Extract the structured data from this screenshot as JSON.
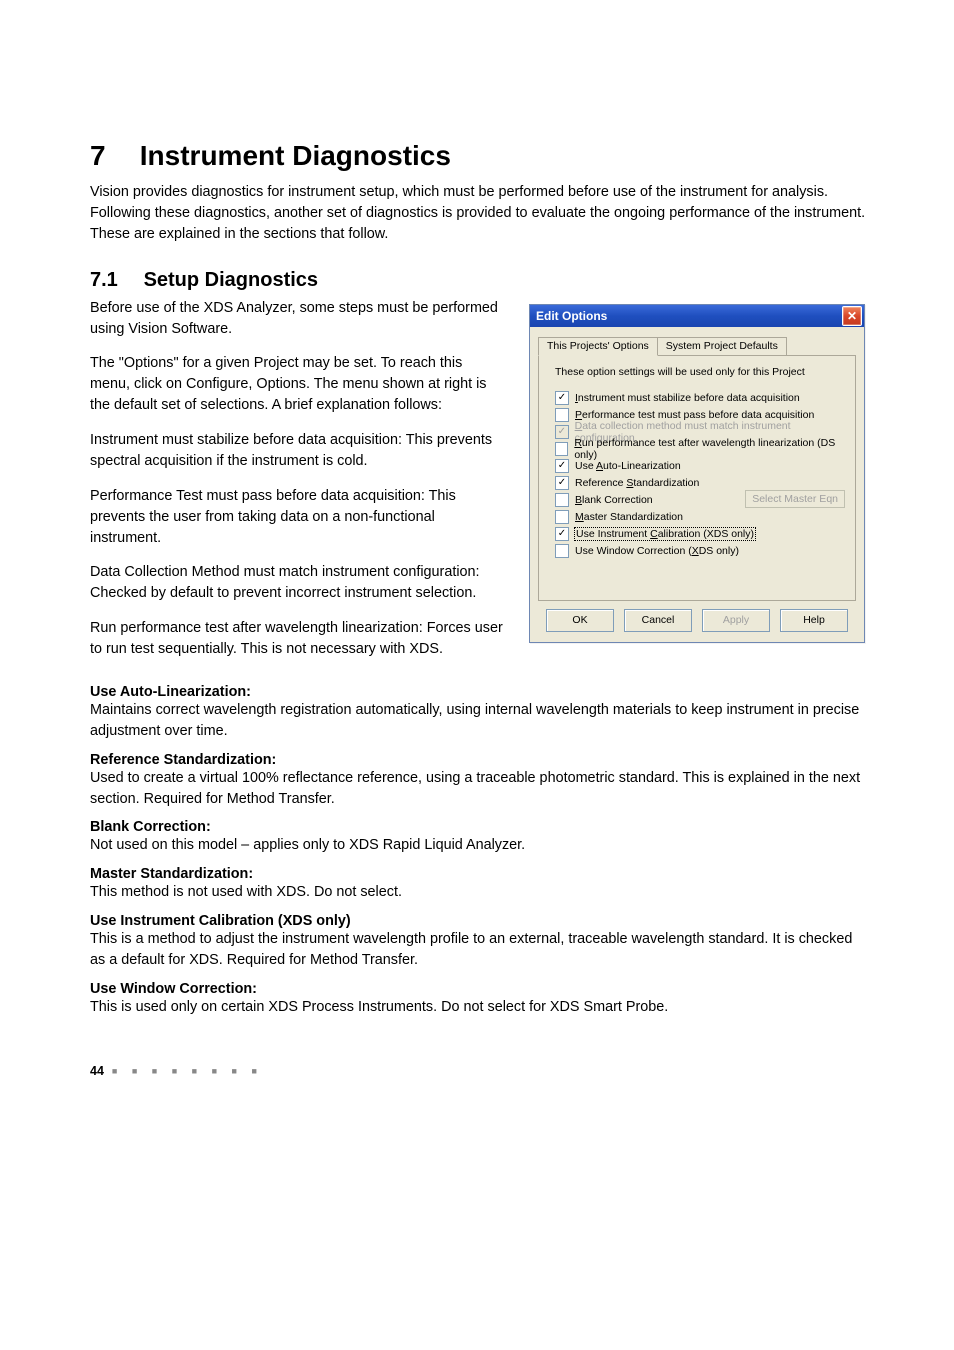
{
  "chapter": {
    "number": "7",
    "title": "Instrument Diagnostics"
  },
  "intro": "Vision provides diagnostics for instrument setup, which must be performed before use of the instrument for analysis. Following these diagnostics, another set of diagnostics is provided to evaluate the ongoing performance of the instrument. These are explained in the sections that follow.",
  "section": {
    "number": "7.1",
    "title": "Setup Diagnostics"
  },
  "left_paragraphs": [
    "Before use of the XDS Analyzer, some steps must be performed using Vision Software.",
    "The \"Options\" for a given Project may be set. To reach this menu, click on Configure, Options. The menu shown at right is the default set of selections. A brief explanation follows:",
    "Instrument must stabilize before data acquisition: This prevents spectral acquisition if the instrument is cold.",
    "Performance Test must pass before data acquisition: This prevents the user from taking data on a non-functional instrument.",
    "Data Collection Method must match instrument configuration:\nChecked by default to prevent incorrect instrument selection.",
    "Run performance test after wavelength linearization: Forces user to run test sequentially. This is not necessary with XDS."
  ],
  "definitions": [
    {
      "head": "Use Auto-Linearization:",
      "body": "Maintains correct wavelength registration automatically, using internal wavelength materials to keep instrument in precise adjustment over time."
    },
    {
      "head": "Reference Standardization:",
      "body": "Used to create a virtual 100% reflectance reference, using a traceable photometric standard. This is explained in the next section. Required for Method Transfer."
    },
    {
      "head": "Blank Correction:",
      "body": "Not used on this model – applies only to XDS Rapid Liquid Analyzer."
    },
    {
      "head": "Master Standardization:",
      "body": "This method is not used with XDS. Do not select."
    },
    {
      "head": "Use Instrument Calibration (XDS only)",
      "body": "This is a method to adjust the instrument wavelength profile to an external, traceable wavelength standard. It is checked as a default for XDS. Required for Method Transfer."
    },
    {
      "head": "Use Window Correction:",
      "body": "This is used only on certain XDS Process Instruments. Do not select for XDS Smart Probe."
    }
  ],
  "dialog": {
    "title": "Edit Options",
    "tabs": {
      "active": "This Projects' Options",
      "inactive": "System Project Defaults"
    },
    "description": "These option settings will be used only for this Project",
    "options": [
      {
        "checked": true,
        "disabled": false,
        "mn": "I",
        "rest": "nstrument must stabilize before data acquisition"
      },
      {
        "checked": false,
        "disabled": false,
        "mn": "P",
        "rest": "erformance test must pass before data acquisition"
      },
      {
        "checked": true,
        "disabled": true,
        "mn": "D",
        "rest": "ata collection method must match instrument configuration"
      },
      {
        "checked": false,
        "disabled": false,
        "mn": "R",
        "rest": "un performance test after wavelength linearization (DS only)"
      },
      {
        "checked": true,
        "disabled": false,
        "pre": "Use ",
        "mn": "A",
        "rest": "uto-Linearization"
      },
      {
        "checked": true,
        "disabled": false,
        "pre": "Reference ",
        "mn": "S",
        "rest": "tandardization"
      },
      {
        "checked": false,
        "disabled": false,
        "mn": "B",
        "rest": "lank Correction",
        "side_button": "Select Master Eqn"
      },
      {
        "checked": false,
        "disabled": false,
        "mn": "M",
        "rest": "aster Standardization"
      },
      {
        "checked": true,
        "disabled": false,
        "pre": "Use Instrument ",
        "mn": "C",
        "rest": "alibration (XDS only)",
        "focus": true
      },
      {
        "checked": false,
        "disabled": false,
        "pre": "Use Window Correction (",
        "mn": "X",
        "rest": "DS only)"
      }
    ],
    "buttons": {
      "ok": "OK",
      "cancel": "Cancel",
      "apply": "Apply",
      "help": "Help"
    }
  },
  "footer": {
    "page": "44",
    "dots": "■ ■ ■ ■ ■ ■ ■ ■"
  }
}
